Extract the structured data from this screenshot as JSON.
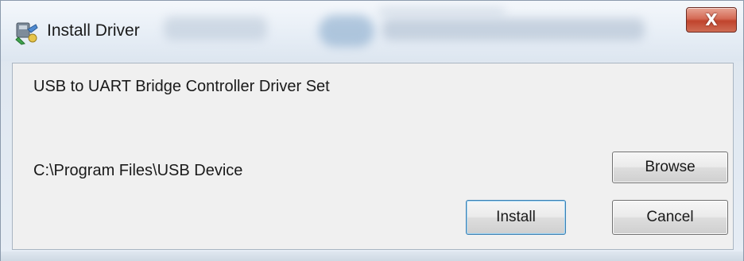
{
  "window": {
    "title": "Install Driver",
    "close_label": "X"
  },
  "main": {
    "heading": "USB to UART Bridge Controller Driver Set",
    "install_path": "C:\\Program Files\\USB Device"
  },
  "buttons": {
    "browse_label": "Browse",
    "install_label": "Install",
    "cancel_label": "Cancel"
  },
  "colors": {
    "close_button": "#c8533d",
    "client_background": "#f0f0f0",
    "default_button_border": "#3c7fb1"
  }
}
